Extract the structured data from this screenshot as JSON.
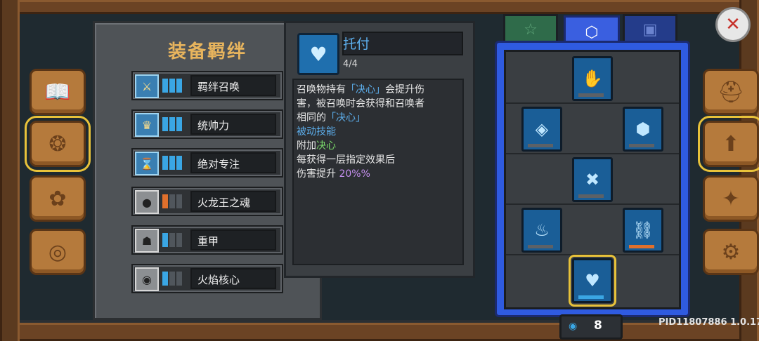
{
  "panel": {
    "title": "装备羁绊"
  },
  "bonds": [
    {
      "name": "羁绊召唤",
      "icon": "sword-emblem-icon",
      "level_color": "blue"
    },
    {
      "name": "统帅力",
      "icon": "trophy-icon",
      "level_color": "blue"
    },
    {
      "name": "绝对专注",
      "icon": "hourglass-icon",
      "level_color": "blue"
    },
    {
      "name": "火龙王之魂",
      "icon": "bomb-icon",
      "level_color": "orange"
    },
    {
      "name": "重甲",
      "icon": "armor-icon",
      "level_color": "blue"
    },
    {
      "name": "火焰核心",
      "icon": "fire-core-icon",
      "level_color": "blue"
    }
  ],
  "detail": {
    "name": "托付",
    "level": "4/4",
    "lines": {
      "l1a": "召唤物持有",
      "l1b": "「决心」",
      "l1c": "会提升伤",
      "l2": "害，被召唤时会获得和召唤者",
      "l3a": "相同的",
      "l3b": "「决心」",
      "passive": "被动技能",
      "l5a": "附加",
      "l5b": "决心",
      "l6": "每获得一层指定效果后",
      "l7a": "伤害提升 ",
      "l7b": "20%%"
    }
  },
  "tabs": [
    "star-tab",
    "hexagon-tab",
    "frame-tab"
  ],
  "coins": {
    "value": "8"
  },
  "version": "PID11807886 1.0.17",
  "colors": {
    "accent_blue": "#3a5fe0",
    "gold": "#e7b45d",
    "orange": "#e0702c"
  }
}
